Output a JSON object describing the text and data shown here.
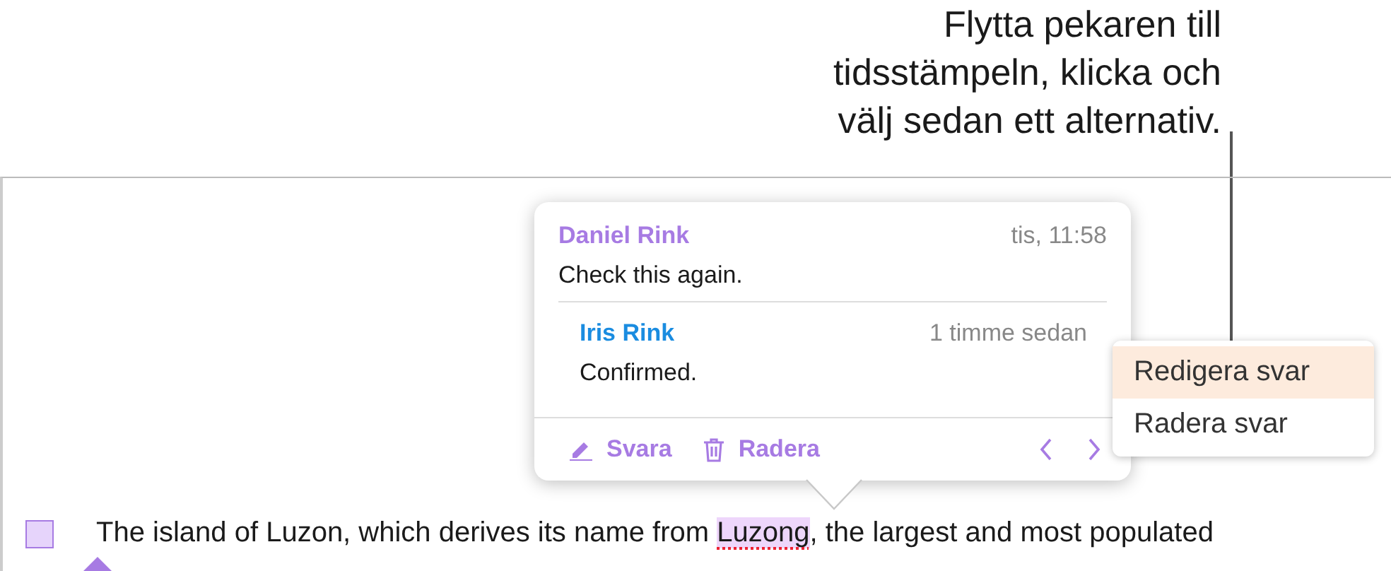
{
  "callout": {
    "text": "Flytta pekaren till tidsstämpeln, klicka och välj sedan ett alternativ."
  },
  "comment_popover": {
    "comments": [
      {
        "kind": "comment",
        "author": "Daniel Rink",
        "color": "#a77be3",
        "time": "tis, 11:58",
        "text": "Check this again."
      },
      {
        "kind": "reply",
        "author": "Iris Rink",
        "color": "#1a8ce0",
        "time": "1 timme sedan",
        "text": "Confirmed."
      }
    ],
    "actions": [
      {
        "kind": "reply",
        "label": "Svara"
      },
      {
        "kind": "delete",
        "label": "Radera"
      }
    ]
  },
  "context_menu": {
    "items": [
      {
        "label": "Redigera svar",
        "selected": true
      },
      {
        "label": "Radera svar",
        "selected": false
      }
    ]
  },
  "document": {
    "segments": [
      {
        "kind": "plain",
        "text": "The island of Luzon, which derives its name from "
      },
      {
        "kind": "commented",
        "text": "Luzong"
      },
      {
        "kind": "plain",
        "text": ", the largest and most populated"
      }
    ]
  }
}
